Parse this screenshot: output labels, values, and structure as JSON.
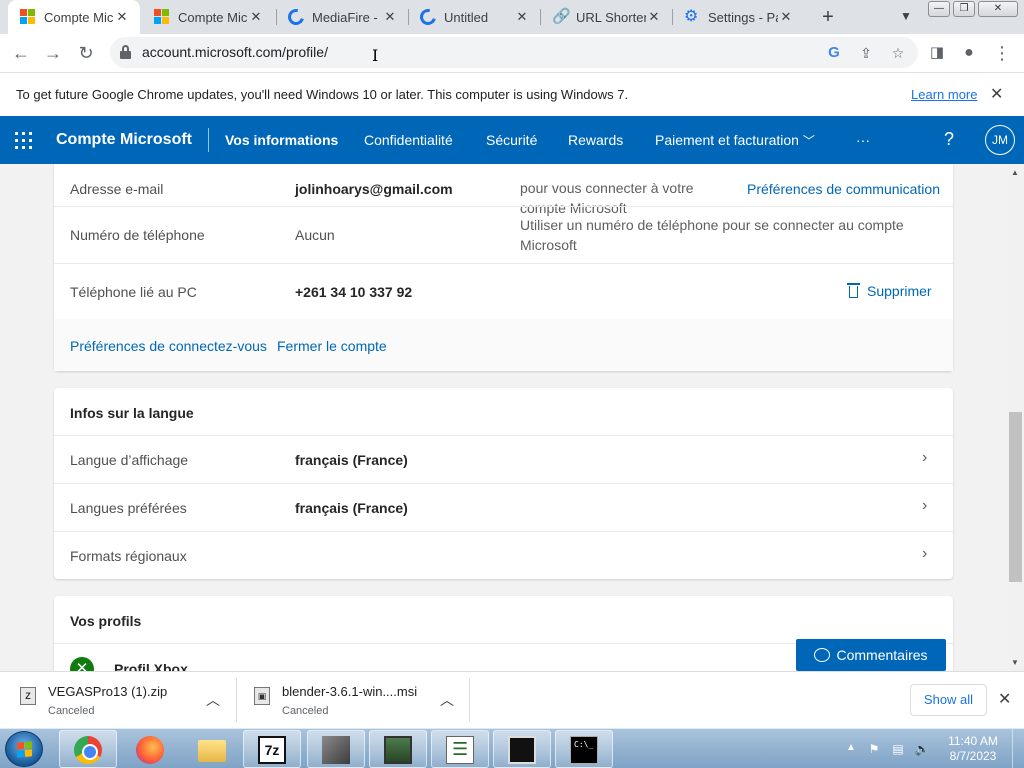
{
  "browser": {
    "tabs": [
      {
        "title": "Compte Micr",
        "icon": "microsoft-icon",
        "active": true
      },
      {
        "title": "Compte Micr",
        "icon": "microsoft-icon",
        "active": false
      },
      {
        "title": "MediaFire - F",
        "icon": "mediafire-icon",
        "active": false
      },
      {
        "title": "Untitled",
        "icon": "mediafire-icon",
        "active": false
      },
      {
        "title": "URL Shortene",
        "icon": "link-icon",
        "active": false
      },
      {
        "title": "Settings - Pa",
        "icon": "gear-icon",
        "active": false
      }
    ],
    "tab_close": "✕",
    "new_tab": "+",
    "url": "account.microsoft.com/profile/",
    "window_buttons": {
      "minimize": "—",
      "maximize": "❐",
      "close": "✕"
    }
  },
  "infobar": {
    "message": "To get future Google Chrome updates, you'll need Windows 10 or later. This computer is using Windows 7.",
    "link": "Learn more",
    "close": "✕"
  },
  "msnav": {
    "brand": "Compte Microsoft",
    "items": [
      "Vos informations",
      "Confidentialité",
      "Sécurité",
      "Rewards",
      "Paiement et facturation",
      "···"
    ],
    "active_item": "Vos informations",
    "help": "?",
    "avatar_initials": "JM"
  },
  "account_info": {
    "email": {
      "label": "Adresse e-mail",
      "value": "jolinhoarys@gmail.com",
      "note": "pour vous connecter à votre compte Microsoft",
      "link": "Préférences de communication"
    },
    "phone": {
      "label": "Numéro de téléphone",
      "value": "Aucun",
      "note": "Utiliser un numéro de téléphone pour se connecter au compte Microsoft"
    },
    "pc_phone": {
      "label": "Téléphone lié au PC",
      "value": "+261 34 10 337 92",
      "action": "Supprimer"
    },
    "footer_links": [
      "Préférences de connectez-vous",
      "Fermer le compte"
    ]
  },
  "language": {
    "title": "Infos sur la langue",
    "rows": [
      {
        "label": "Langue d’affichage",
        "value": "français (France)"
      },
      {
        "label": "Langues préférées",
        "value": "français (France)"
      },
      {
        "label": "Formats régionaux",
        "value": ""
      }
    ]
  },
  "profiles": {
    "title": "Vos profils",
    "xbox_label": "Profil Xbox"
  },
  "feedback": {
    "label": "Commentaires"
  },
  "downloads": {
    "items": [
      {
        "name": "VEGASPro13 (1).zip",
        "status": "Canceled"
      },
      {
        "name": "blender-3.6.1-win....msi",
        "status": "Canceled"
      }
    ],
    "show_all": "Show all",
    "close": "✕"
  },
  "taskbar": {
    "apps": [
      "chrome-icon",
      "firefox-icon",
      "folder-icon",
      "7zip-icon",
      "film-app-icon",
      "monitor-app-icon",
      "task-list-icon",
      "clapper-icon",
      "cmd-icon"
    ],
    "zip_label": "7z",
    "clock_time": "11:40 AM",
    "clock_date": "8/7/2023"
  }
}
